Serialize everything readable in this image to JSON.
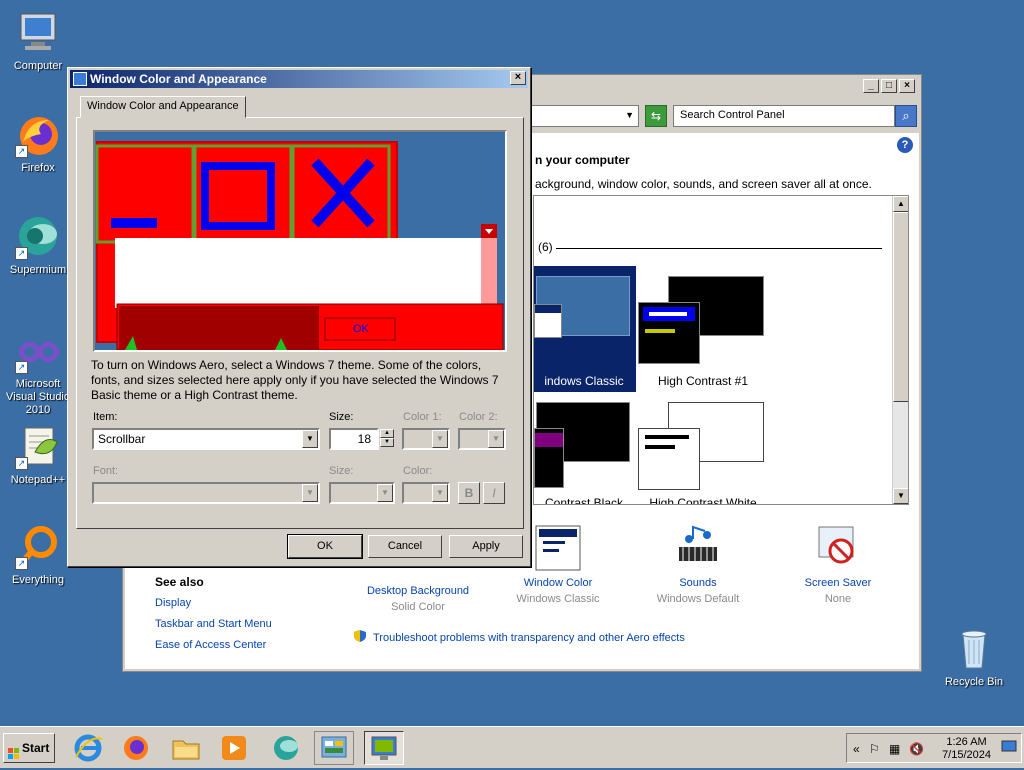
{
  "desktop": {
    "icons": [
      {
        "label": "Computer"
      },
      {
        "label": "Firefox"
      },
      {
        "label": "Supermium"
      },
      {
        "label": "Microsoft Visual Studio 2010"
      },
      {
        "label": "Notepad++"
      },
      {
        "label": "Everything"
      },
      {
        "label": "Recycle Bin"
      }
    ]
  },
  "control_panel": {
    "search_placeholder": "Search Control Panel",
    "heading": "n your computer",
    "subheading": "ackground, window color, sounds, and screen saver all at once.",
    "theme_group_count": "(6)",
    "themes": [
      {
        "label": "indows Classic",
        "selected": true
      },
      {
        "label": "High Contrast #1",
        "selected": false
      },
      {
        "label": "Contrast Black",
        "selected": false
      },
      {
        "label": "High Contrast White",
        "selected": false
      }
    ],
    "bottom_items": [
      {
        "title": "Desktop Background",
        "value": "Solid Color"
      },
      {
        "title": "Window Color",
        "value": "Windows Classic"
      },
      {
        "title": "Sounds",
        "value": "Windows Default"
      },
      {
        "title": "Screen Saver",
        "value": "None"
      }
    ],
    "see_also": {
      "title": "See also",
      "links": [
        "Display",
        "Taskbar and Start Menu",
        "Ease of Access Center"
      ]
    },
    "troubleshoot": "Troubleshoot problems with transparency and other Aero effects"
  },
  "dialog": {
    "title": "Window Color and Appearance",
    "tab": "Window Color and Appearance",
    "aero_text": "To turn on Windows Aero, select a Windows 7 theme.  Some of the colors, fonts, and sizes selected here apply only if you have selected the Windows 7 Basic theme or a High Contrast theme.",
    "preview_ok": "OK",
    "item_label": "Item:",
    "item_value": "Scrollbar",
    "size_label": "Size:",
    "size_value": "18",
    "color1_label": "Color 1:",
    "color2_label": "Color 2:",
    "font_label": "Font:",
    "font_size_label": "Size:",
    "font_color_label": "Color:",
    "bold_label": "B",
    "italic_label": "I",
    "buttons": {
      "ok": "OK",
      "cancel": "Cancel",
      "apply": "Apply"
    }
  },
  "taskbar": {
    "start_label": "Start",
    "time": "1:26 AM",
    "date": "7/15/2024"
  },
  "colors": {
    "desktop": "#3a6ea5",
    "preview_red": "#ff0000",
    "preview_blue": "#0000ee",
    "theme_selected": "#0a246a"
  }
}
